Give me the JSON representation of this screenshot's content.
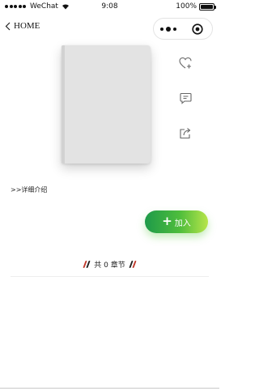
{
  "status_bar": {
    "carrier": "WeChat",
    "time": "9:08",
    "battery_text": "100%",
    "battery_level": 1.0
  },
  "nav": {
    "back_label": "HOME"
  },
  "side_actions": {
    "icons": [
      "heart-plus-icon",
      "comment-icon",
      "share-icon"
    ]
  },
  "detail_link": ">>详细介绍",
  "join_button": {
    "label": "加入",
    "icon": "plus-icon",
    "gradient": [
      "#1e9a4a",
      "#4ebd3c",
      "#b7e54a"
    ]
  },
  "chapters": {
    "text": "共 0 章节",
    "deco_colors": [
      "#c0392b",
      "#222222"
    ]
  },
  "colors": {
    "cover": "#e3e3e3",
    "icon_gray": "#666666"
  }
}
